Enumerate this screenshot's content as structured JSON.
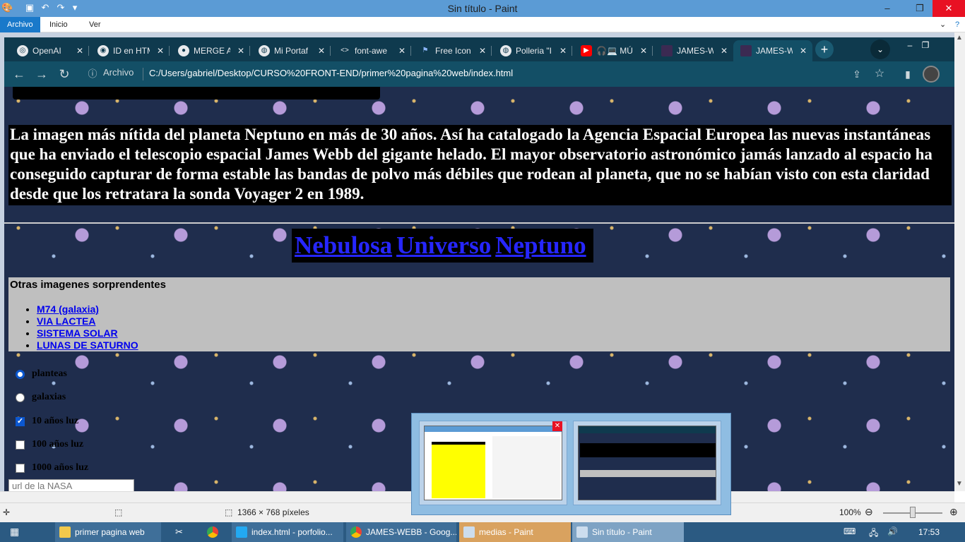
{
  "paint": {
    "title": "Sin título - Paint",
    "ribbon_tabs": [
      "Archivo",
      "Inicio",
      "Ver"
    ],
    "status_dimensions": "1366 × 768 píxeles",
    "zoom": "100%"
  },
  "chrome": {
    "tabs": [
      "OpenAI",
      "ID en HTM",
      "MERGE A",
      "Mi Portaf",
      "font-awe",
      "Free Icon",
      "Polleria \"I",
      "🎧💻 MÚ",
      "JAMES-W",
      "JAMES-W"
    ],
    "address_label": "Archivo",
    "url": "C:/Users/gabriel/Desktop/CURSO%20FRONT-END/primer%20pagina%20web/index.html"
  },
  "page": {
    "intro": "La imagen más nítida del planeta Neptuno en más de 30 años. Así ha catalogado la Agencia Espacial Europea las nuevas instantáneas que ha enviado el telescopio espacial James Webb del gigante helado. El mayor observatorio astronómico jamás lanzado al espacio ha conseguido capturar de forma estable las bandas de polvo más débiles que rodean al planeta, que no se habían visto con esta claridad desde que los retratara la sonda Voyager 2 en 1989.",
    "links": [
      "Nebulosa",
      "Universo",
      "Neptuno"
    ],
    "others_title": "Otras imagenes sorprendentes",
    "others_list": [
      "M74 (galaxia)",
      "VIA LACTEA",
      "SISTEMA SOLAR",
      "LUNAS DE SATURNO"
    ],
    "radios": [
      {
        "label": "planteas",
        "checked": true
      },
      {
        "label": "galaxias",
        "checked": false
      }
    ],
    "checkboxes": [
      {
        "label": "10 años luz",
        "checked": true
      },
      {
        "label": "100 años luz",
        "checked": false
      },
      {
        "label": "1000 años luz",
        "checked": false
      }
    ],
    "nasa_placeholder": "url de la NASA"
  },
  "taskbar": {
    "items": [
      "primer pagina web",
      "index.html - porfolio...",
      "JAMES-WEBB - Goog...",
      "medias - Paint",
      "Sin título - Paint"
    ],
    "clock": "17:53"
  },
  "colors": {
    "paint_title_bg": "#5b9bd5",
    "chrome_bg": "#0f3a4e",
    "taskbar_bg": "#2b5a82"
  }
}
